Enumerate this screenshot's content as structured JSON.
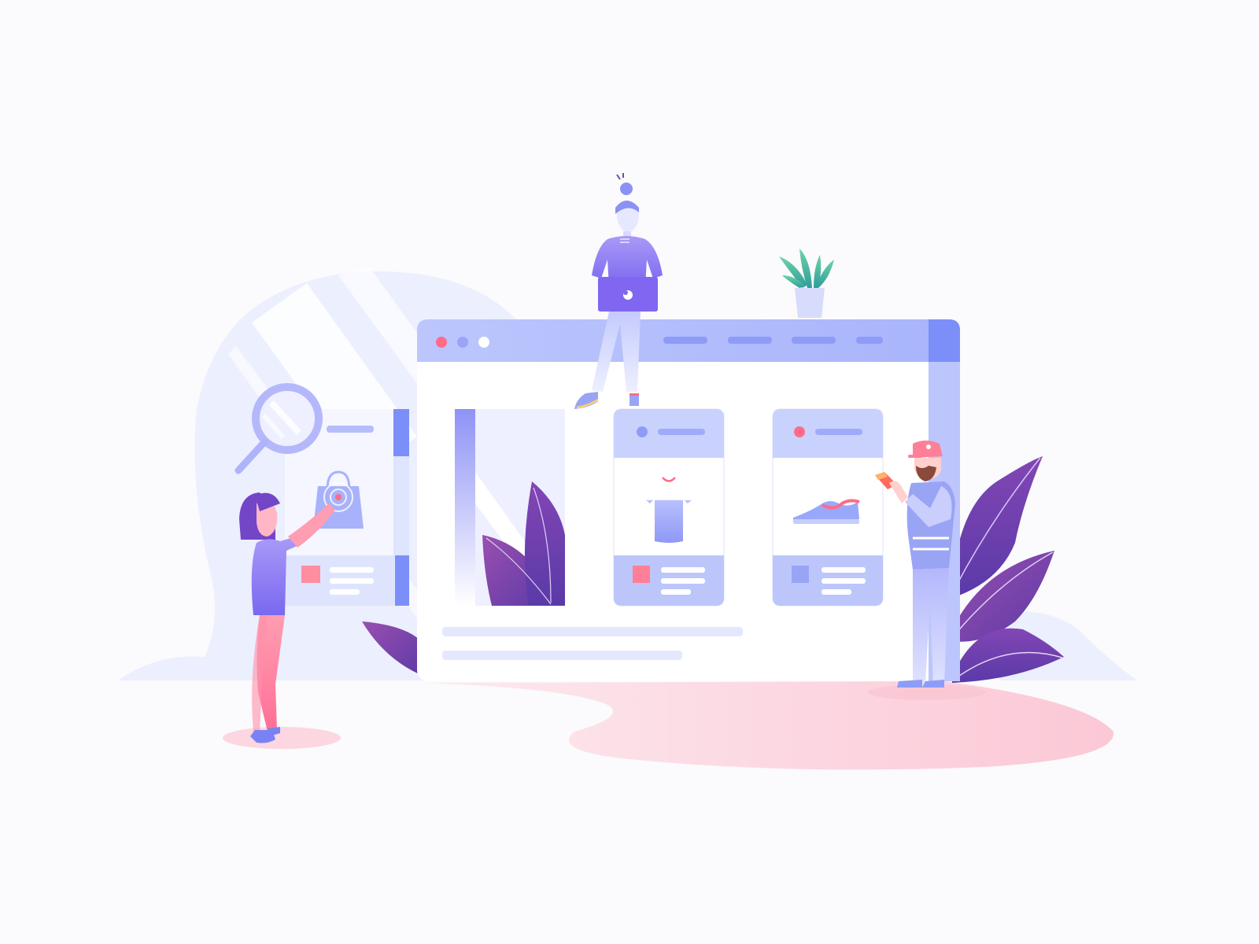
{
  "scene": {
    "description_free": true,
    "colors": {
      "background": "#fbfafc",
      "blob": "#eceffd",
      "window_bar": "#b8c3fd",
      "window_accent": "#7c8ff9",
      "dot_red": "#ff6b8a",
      "dot_purple": "#9aa4f5",
      "dot_white": "#ffffff",
      "card_header": "#c9d1fd",
      "card_footer": "#bcc6fb",
      "pink_floor": "#fcd6e0",
      "leaf_dark": "#6a3fa8",
      "leaf_mid": "#8a4fb8",
      "plant_green": "#4fc89a",
      "person_purple": "#8c7cf5",
      "person_pink": "#ff8fa8"
    },
    "icons": [
      "browser-window-illustration",
      "magnifier-icon",
      "shopping-bag-icon",
      "tshirt-icon",
      "sneaker-icon",
      "laptop-icon",
      "potted-plant-icon",
      "phone-icon",
      "leaf-decoration"
    ],
    "window": {
      "nav_items": 4,
      "cards": 3
    }
  }
}
